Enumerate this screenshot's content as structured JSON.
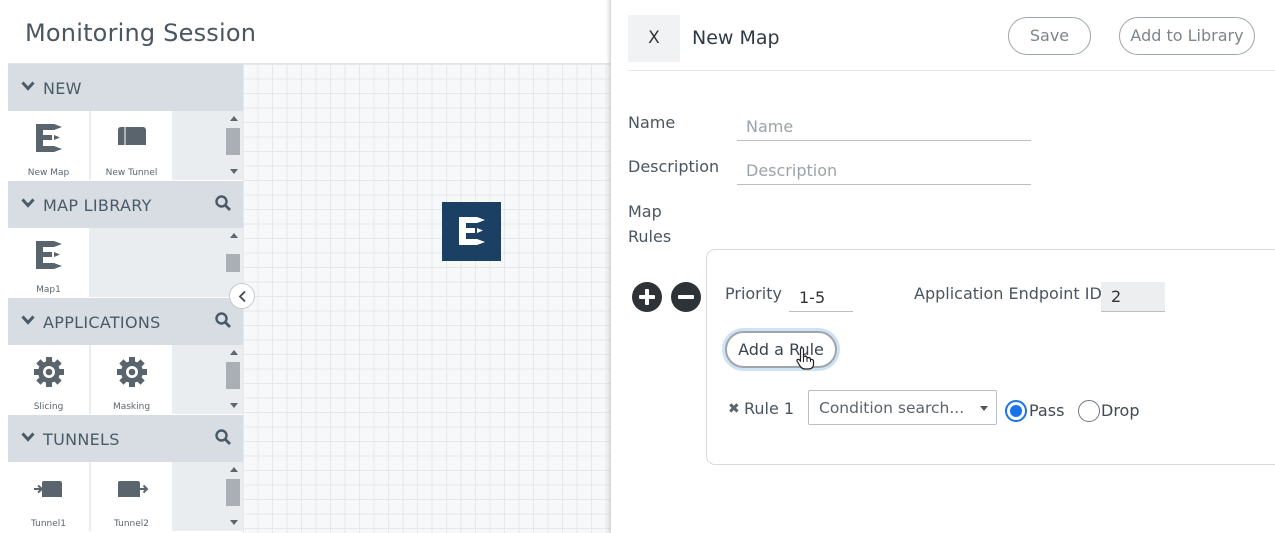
{
  "session": {
    "title": "Monitoring Session"
  },
  "palette": {
    "sections": [
      {
        "name": "NEW",
        "has_search": false,
        "items": [
          "New Map",
          "New Tunnel"
        ]
      },
      {
        "name": "MAP LIBRARY",
        "has_search": true,
        "items": [
          "Map1"
        ]
      },
      {
        "name": "APPLICATIONS",
        "has_search": true,
        "items": [
          "Slicing",
          "Masking"
        ]
      },
      {
        "name": "TUNNELS",
        "has_search": true,
        "items": [
          "Tunnel1",
          "Tunnel2"
        ]
      }
    ],
    "icons": {
      "section_toggle": "chevron-down-icon",
      "section_search": "search-icon",
      "map": "map-icon",
      "tunnel": "tunnel-icon",
      "application": "gear-icon",
      "collapse": "chevron-left-icon"
    }
  },
  "canvas": {
    "node_icon": "map-icon",
    "node_color": "#1c3f64"
  },
  "drawer": {
    "close_label": "X",
    "title": "New Map",
    "save_label": "Save",
    "add_to_library_label": "Add to Library",
    "name": {
      "label": "Name",
      "placeholder": "Name",
      "value": ""
    },
    "description": {
      "label": "Description",
      "placeholder": "Description",
      "value": ""
    },
    "map_rules": {
      "label_line1": "Map",
      "label_line2": "Rules",
      "add_icon": "plus-circle-icon",
      "remove_icon": "minus-circle-icon",
      "priority": {
        "label": "Priority",
        "value": "1-5"
      },
      "app_endpoint": {
        "label": "Application Endpoint ID",
        "value": "2"
      },
      "add_rule_label": "Add a Rule",
      "rules": [
        {
          "label": "Rule 1",
          "remove_icon": "close-icon",
          "condition_placeholder": "Condition search...",
          "action_options": [
            "Pass",
            "Drop"
          ],
          "action_selected": "Pass"
        }
      ]
    }
  },
  "colors": {
    "accent": "#1a73e8",
    "header_bg": "#d7dde2",
    "map_tile": "#1c3f64"
  }
}
